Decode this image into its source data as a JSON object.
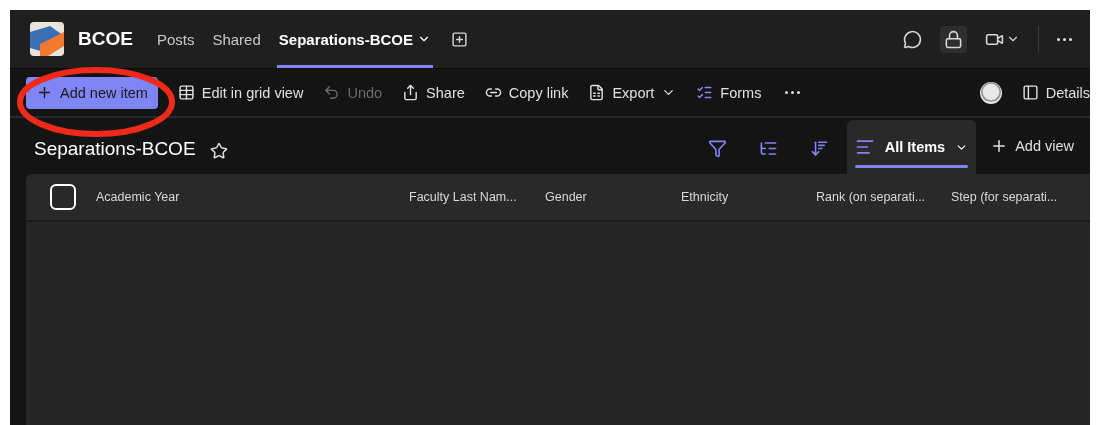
{
  "header": {
    "team_name": "BCOE",
    "tabs": [
      {
        "label": "Posts",
        "selected": false,
        "has_menu": false
      },
      {
        "label": "Shared",
        "selected": false,
        "has_menu": false
      },
      {
        "label": "Separations-BCOE",
        "selected": true,
        "has_menu": true
      }
    ]
  },
  "toolbar": {
    "items": [
      {
        "kind": "primary",
        "label": "Add new item",
        "disabled": false
      },
      {
        "kind": "grid",
        "label": "Edit in grid view",
        "disabled": false
      },
      {
        "kind": "undo",
        "label": "Undo",
        "disabled": true
      },
      {
        "kind": "share",
        "label": "Share",
        "disabled": false
      },
      {
        "kind": "link",
        "label": "Copy link",
        "disabled": false
      },
      {
        "kind": "export",
        "label": "Export",
        "disabled": false
      },
      {
        "kind": "forms",
        "label": "Forms",
        "disabled": false
      }
    ],
    "details_label": "Details"
  },
  "list": {
    "title": "Separations-BCOE",
    "favorite": false,
    "views": [
      {
        "label": "All Items",
        "selected": true
      }
    ],
    "add_view_label": "Add view",
    "select_all_checked": false,
    "columns": [
      "Academic Year",
      "Faculty Last Nam...",
      "Gender",
      "Ethnicity",
      "Rank (on separati...",
      "Step (for separati..."
    ]
  }
}
